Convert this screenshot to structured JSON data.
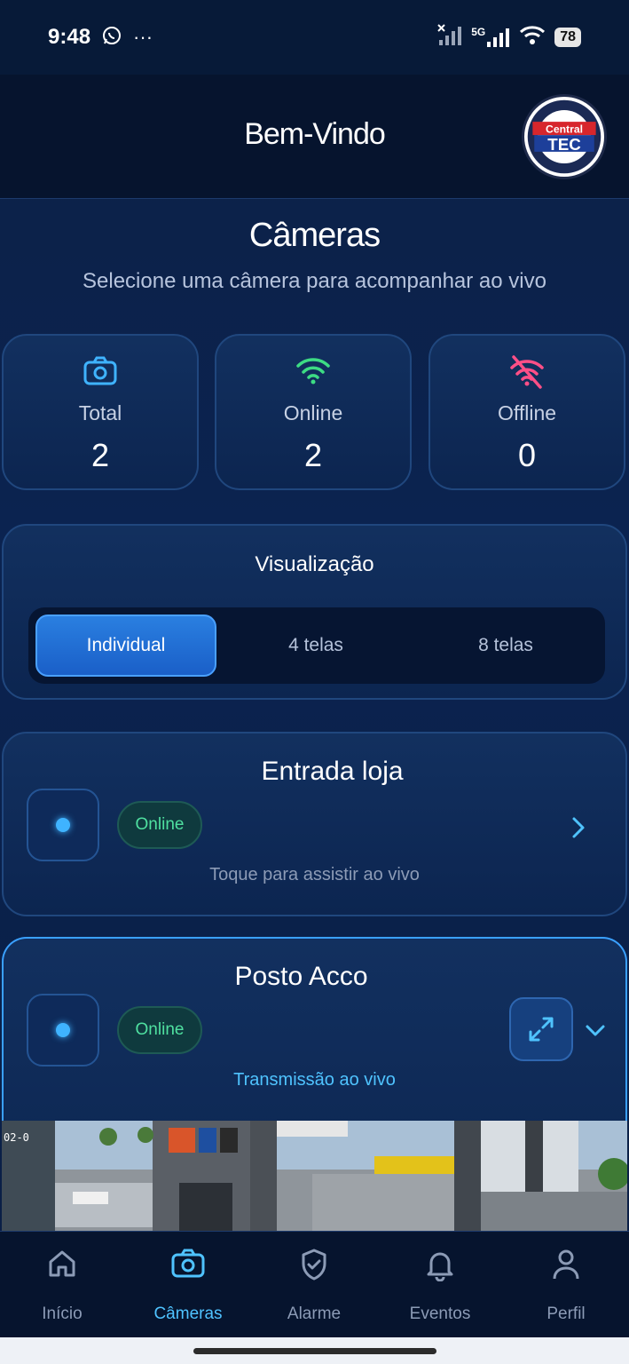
{
  "status_bar": {
    "time": "9:48",
    "network": "5G",
    "battery": "78"
  },
  "header": {
    "title": "Bem-Vindo",
    "logo_text": "Central TEC"
  },
  "page": {
    "title": "Câmeras",
    "subtitle": "Selecione uma câmera para acompanhar ao vivo"
  },
  "stats": [
    {
      "label": "Total",
      "value": "2",
      "icon": "camera-icon",
      "color": "#3fb3ff"
    },
    {
      "label": "Online",
      "value": "2",
      "icon": "wifi-icon",
      "color": "#3ddc84"
    },
    {
      "label": "Offline",
      "value": "0",
      "icon": "wifi-off-icon",
      "color": "#ff4f87"
    }
  ],
  "visualizacao": {
    "title": "Visualização",
    "options": [
      "Individual",
      "4 telas",
      "8 telas"
    ],
    "selected": "Individual"
  },
  "cameras": [
    {
      "name": "Entrada loja",
      "status": "Online",
      "hint": "Toque para assistir ao vivo"
    },
    {
      "name": "Posto Acco",
      "status": "Online",
      "hint": "Transmissão ao vivo",
      "feed_timestamp": "02-0"
    }
  ],
  "tabs": [
    {
      "label": "Início",
      "icon": "home-icon"
    },
    {
      "label": "Câmeras",
      "icon": "camera-icon"
    },
    {
      "label": "Alarme",
      "icon": "shield-check-icon"
    },
    {
      "label": "Eventos",
      "icon": "bell-icon"
    },
    {
      "label": "Perfil",
      "icon": "user-icon"
    }
  ],
  "active_tab": "Câmeras",
  "colors": {
    "accent": "#3fb3ff",
    "online": "#4fe0a0",
    "offline": "#ff4f87",
    "background": "#0b2350"
  }
}
